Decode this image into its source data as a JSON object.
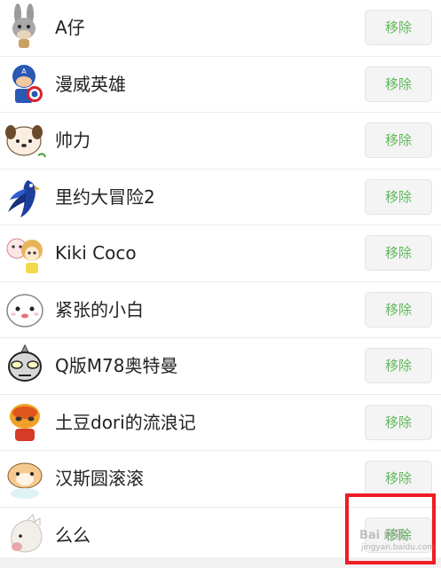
{
  "sticker_list": {
    "remove_label": "移除",
    "items": [
      {
        "name": "A仔",
        "icon": "donkey-icon"
      },
      {
        "name": "漫威英雄",
        "icon": "captain-america-icon"
      },
      {
        "name": "帅力",
        "icon": "puppy-icon"
      },
      {
        "name": "里约大冒险2",
        "icon": "parrot-icon"
      },
      {
        "name": "Kiki Coco",
        "icon": "girls-icon"
      },
      {
        "name": "紧张的小白",
        "icon": "white-blob-icon"
      },
      {
        "name": "Q版M78奥特曼",
        "icon": "ultraman-icon"
      },
      {
        "name": "土豆dori的流浪记",
        "icon": "potato-icon"
      },
      {
        "name": "汉斯圆滚滚",
        "icon": "hamster-icon"
      },
      {
        "name": "么么",
        "icon": "hedgehog-icon"
      }
    ]
  },
  "watermark": {
    "logo": "Bai 经验",
    "url": "jingyan.baidu.com"
  },
  "colors": {
    "remove_text": "#5fb85a",
    "highlight": "#ee1c24"
  }
}
